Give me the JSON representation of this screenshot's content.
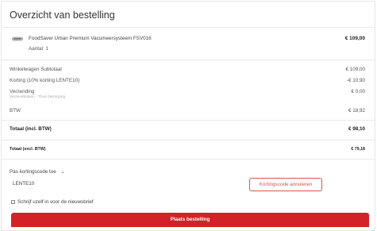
{
  "order_summary": {
    "title": "Overzicht van bestelling",
    "product": {
      "name": "FoodSaver Urban Premium Vacumeersysteem FSV016",
      "quantity": "Aantal: 1",
      "price": "€ 109,00",
      "icon": "vacuum-sealer-icon"
    },
    "subtotal": {
      "label": "Winkelwagen Subtotaal",
      "value": "€ 109,00"
    },
    "discount": {
      "label": "Korting (10% korting LENTE10)",
      "value": "-€ 10,90"
    },
    "shipping": {
      "label": "Verzending",
      "sublabel": "Verzendkosten - Thuis bezorging",
      "value": "€ 0,00"
    },
    "vat": {
      "label": "BTW",
      "value": "€ 18,92"
    },
    "total_incl": {
      "label": "Totaal (incl. BTW)",
      "value": "€ 98,10"
    },
    "total_excl": {
      "label": "Totaal (excl. BTW)",
      "value": "€ 79,18"
    },
    "coupon": {
      "toggle_label": "Pas kortingscode toe",
      "code": "LENTE10",
      "cancel_label": "Kortingscode annuleren"
    },
    "newsletter_label": "Schrijf uzelf in voor de nieuwsbrief",
    "place_order_label": "Plaats bestelling",
    "accent_color": "#d42027"
  }
}
